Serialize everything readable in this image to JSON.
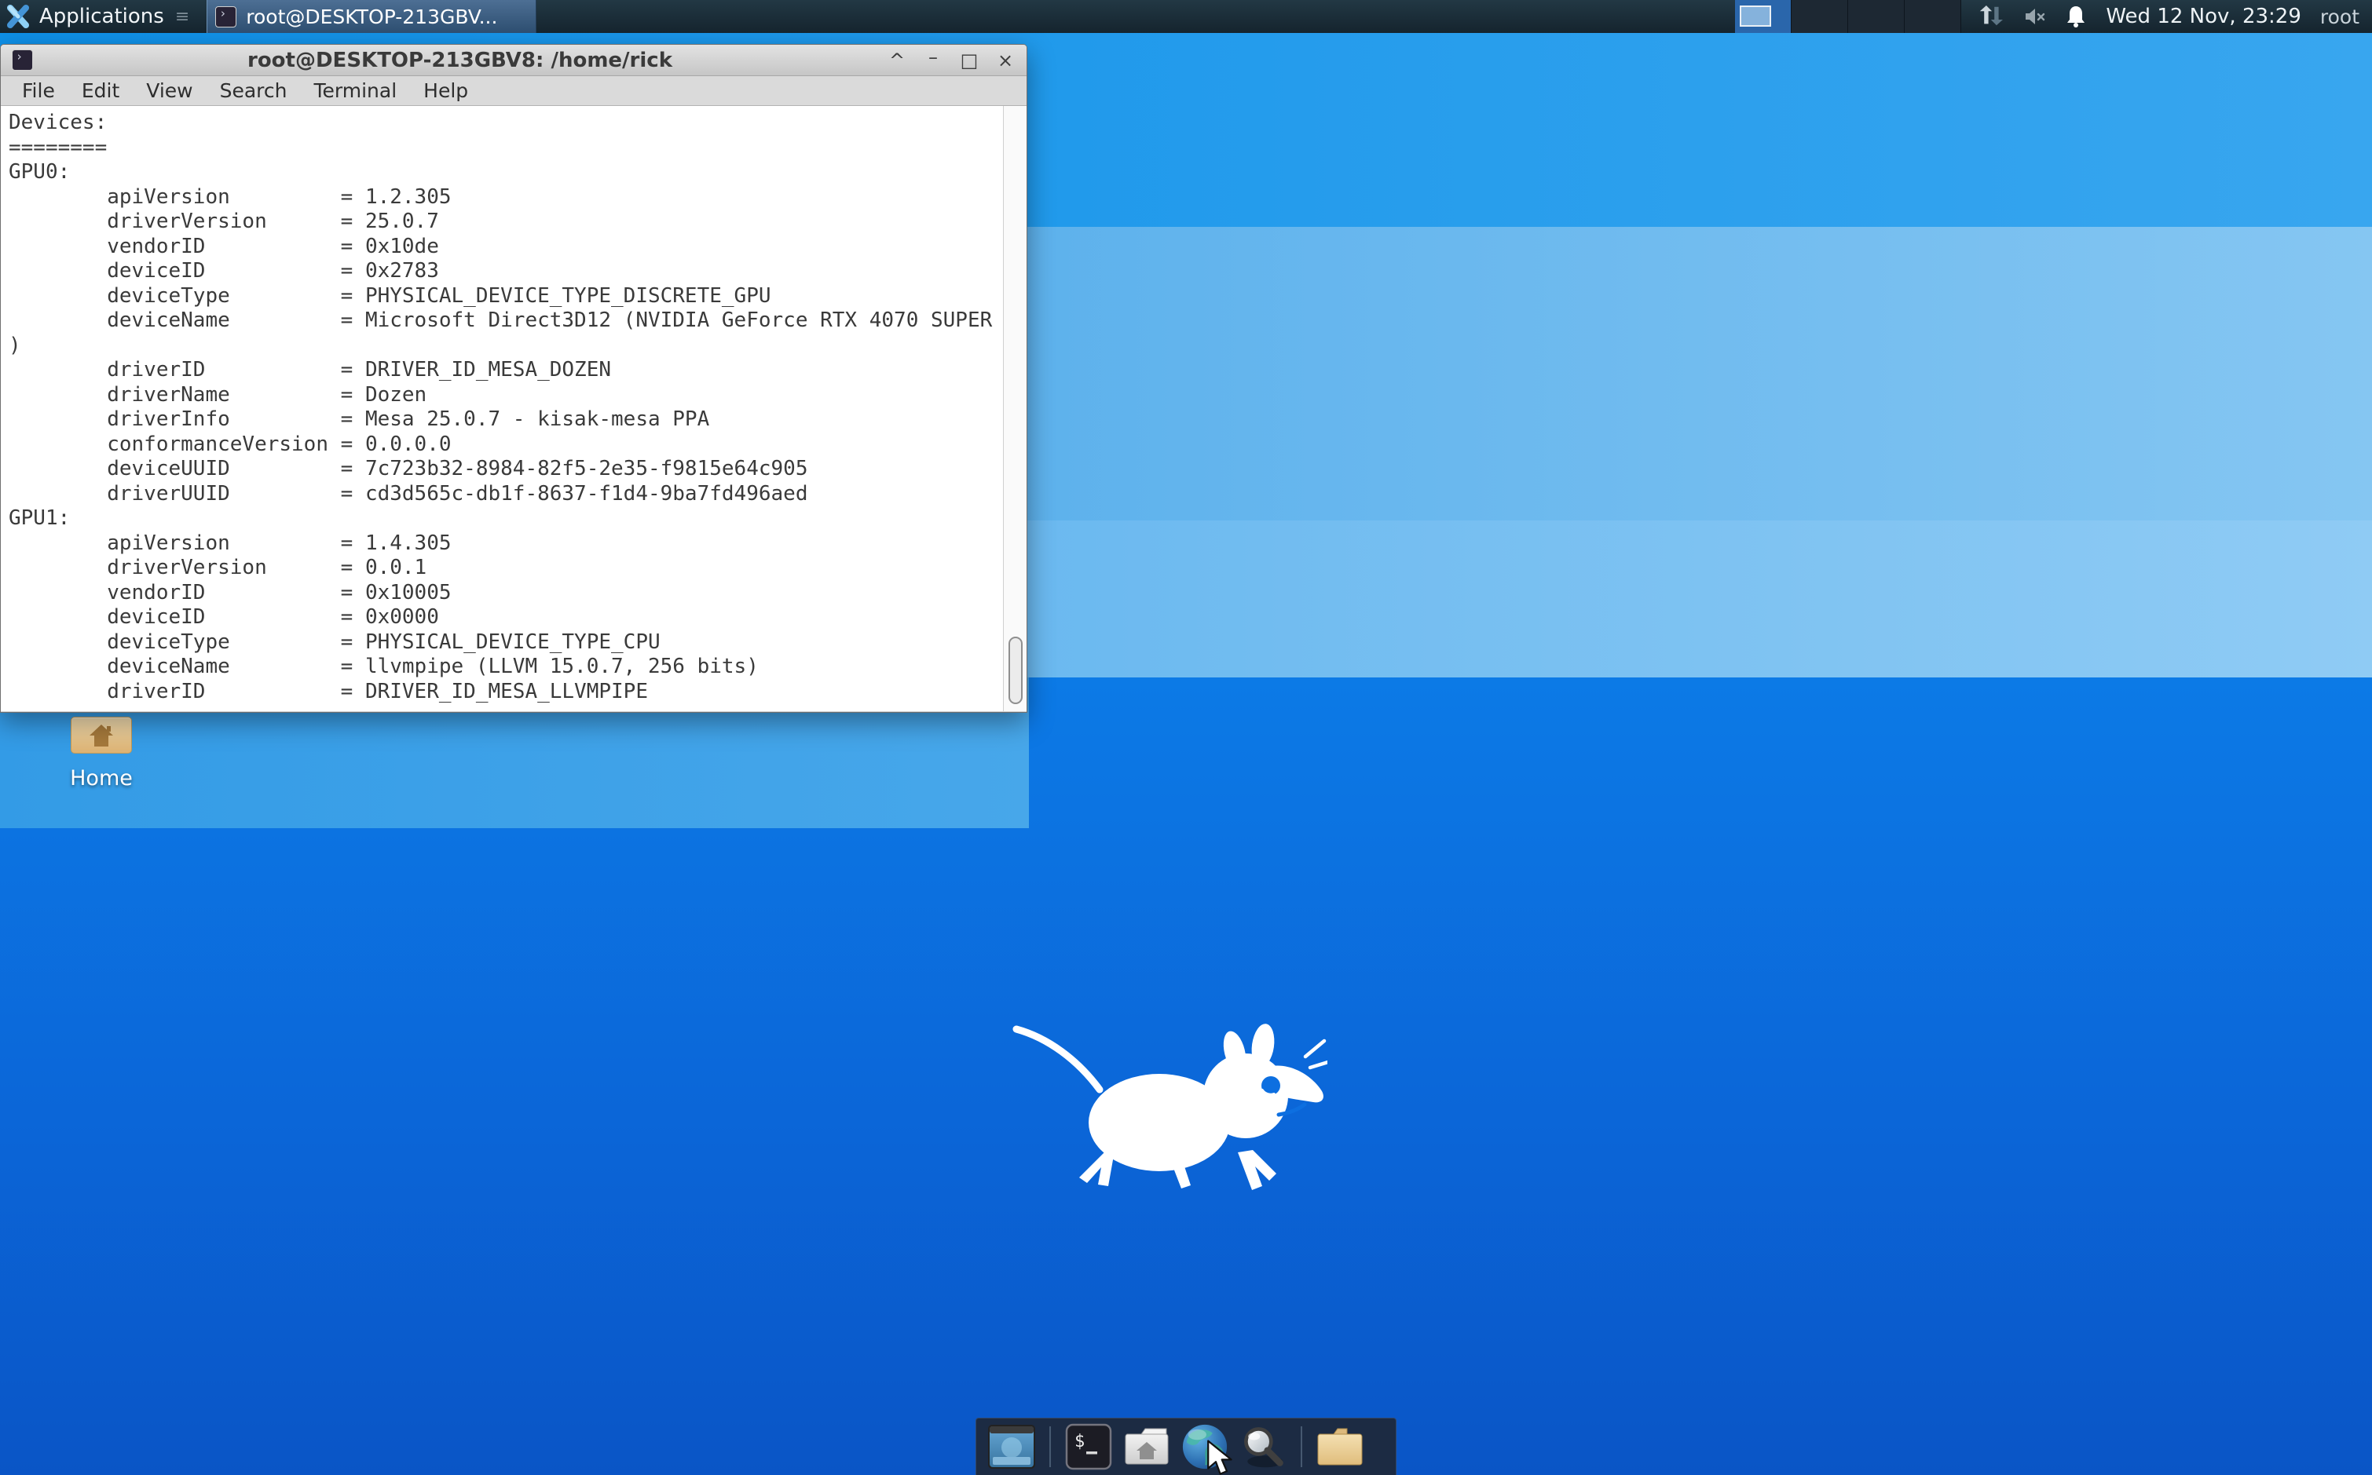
{
  "panel": {
    "applications_label": "Applications",
    "window_button_label": "root@DESKTOP-213GBV...",
    "clock": "Wed 12 Nov, 23:29",
    "user": "root",
    "workspaces": {
      "count": 4,
      "active": 1
    }
  },
  "window": {
    "title": "root@DESKTOP-213GBV8: /home/rick",
    "menu": [
      "File",
      "Edit",
      "View",
      "Search",
      "Terminal",
      "Help"
    ],
    "controls": {
      "shade": "^",
      "minimize": "–",
      "maximize": "□",
      "close": "×"
    }
  },
  "terminal": {
    "lines": [
      "Devices:",
      "========",
      "GPU0:",
      "        apiVersion         = 1.2.305",
      "        driverVersion      = 25.0.7",
      "        vendorID           = 0x10de",
      "        deviceID           = 0x2783",
      "        deviceType         = PHYSICAL_DEVICE_TYPE_DISCRETE_GPU",
      "        deviceName         = Microsoft Direct3D12 (NVIDIA GeForce RTX 4070 SUPER",
      ")",
      "        driverID           = DRIVER_ID_MESA_DOZEN",
      "        driverName         = Dozen",
      "        driverInfo         = Mesa 25.0.7 - kisak-mesa PPA",
      "        conformanceVersion = 0.0.0.0",
      "        deviceUUID         = 7c723b32-8984-82f5-2e35-f9815e64c905",
      "        driverUUID         = cd3d565c-db1f-8637-f1d4-9ba7fd496aed",
      "GPU1:",
      "        apiVersion         = 1.4.305",
      "        driverVersion      = 0.0.1",
      "        vendorID           = 0x10005",
      "        deviceID           = 0x0000",
      "        deviceType         = PHYSICAL_DEVICE_TYPE_CPU",
      "        deviceName         = llvmpipe (LLVM 15.0.7, 256 bits)",
      "        driverID           = DRIVER_ID_MESA_LLVMPIPE"
    ]
  },
  "desktop": {
    "home_label": "Home"
  },
  "dock": {
    "icons": [
      "desktop",
      "terminal",
      "home-folder",
      "web-browser",
      "app-finder",
      "file-manager"
    ]
  },
  "colors": {
    "accent_blue": "#2a66ab",
    "panel_bg": "#1b2f3c",
    "wallpaper_light": "#85c6f2",
    "wallpaper_deep": "#0a55c6",
    "dock_bg": "#1c2b43"
  }
}
